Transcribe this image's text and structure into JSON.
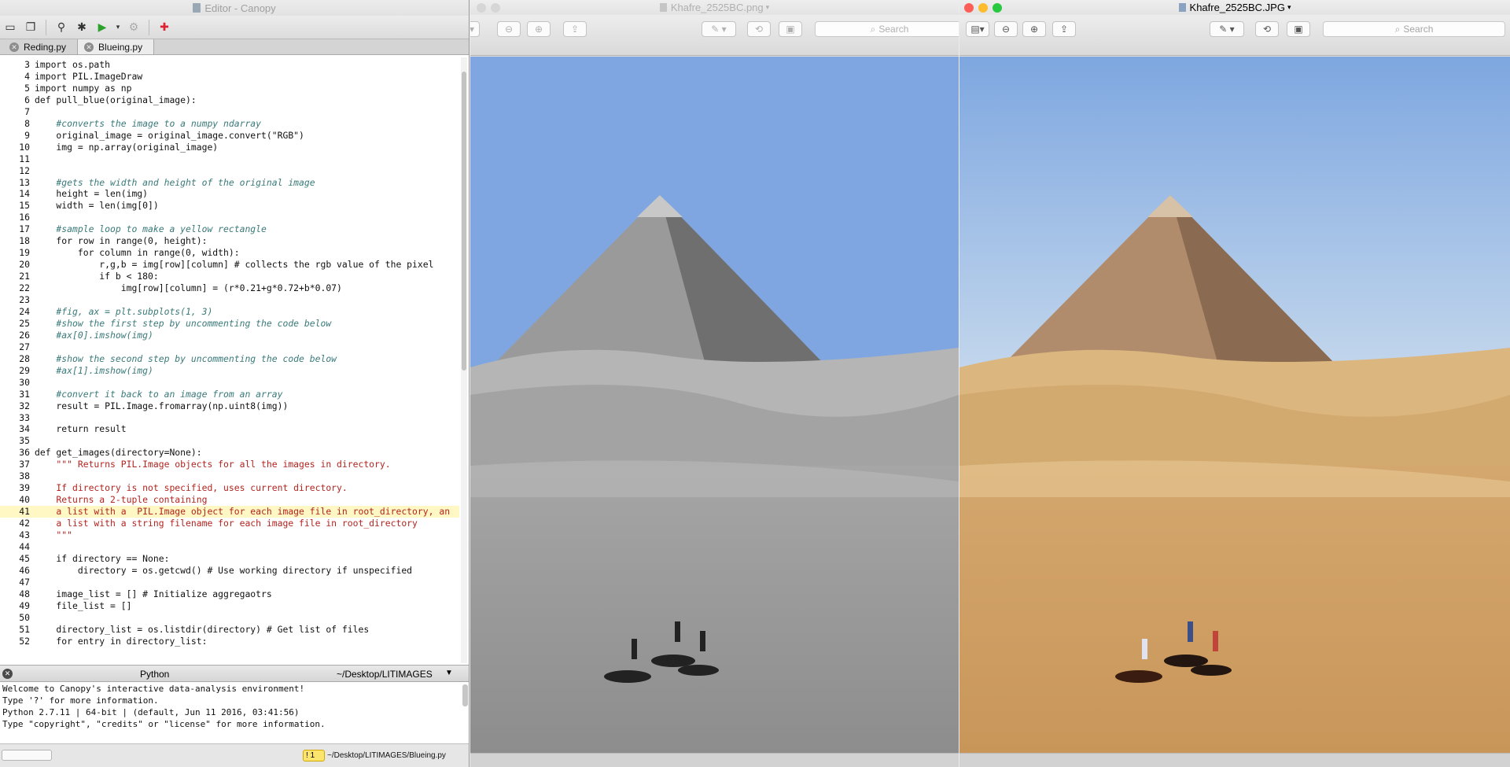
{
  "canopy": {
    "window_title": "Editor - Canopy",
    "tabs": [
      {
        "label": "Reding.py",
        "active": false
      },
      {
        "label": "Blueing.py",
        "active": true
      }
    ],
    "code": [
      {
        "n": "3",
        "text": "import os.path"
      },
      {
        "n": "4",
        "text": "import PIL.ImageDraw"
      },
      {
        "n": "5",
        "text": "import numpy as np"
      },
      {
        "n": "6",
        "text": "def pull_blue(original_image):"
      },
      {
        "n": "7",
        "text": ""
      },
      {
        "n": "8",
        "text": "    #converts the image to a numpy ndarray"
      },
      {
        "n": "9",
        "text": "    original_image = original_image.convert(\"RGB\")"
      },
      {
        "n": "10",
        "text": "    img = np.array(original_image)"
      },
      {
        "n": "11",
        "text": ""
      },
      {
        "n": "12",
        "text": ""
      },
      {
        "n": "13",
        "text": "    #gets the width and height of the original image"
      },
      {
        "n": "14",
        "text": "    height = len(img)"
      },
      {
        "n": "15",
        "text": "    width = len(img[0])"
      },
      {
        "n": "16",
        "text": ""
      },
      {
        "n": "17",
        "text": "    #sample loop to make a yellow rectangle"
      },
      {
        "n": "18",
        "text": "    for row in range(0, height):"
      },
      {
        "n": "19",
        "text": "        for column in range(0, width):"
      },
      {
        "n": "20",
        "text": "            r,g,b = img[row][column] # collects the rgb value of the pixel"
      },
      {
        "n": "21",
        "text": "            if b < 180:"
      },
      {
        "n": "22",
        "text": "                img[row][column] = (r*0.21+g*0.72+b*0.07)"
      },
      {
        "n": "23",
        "text": ""
      },
      {
        "n": "24",
        "text": "    #fig, ax = plt.subplots(1, 3)"
      },
      {
        "n": "25",
        "text": "    #show the first step by uncommenting the code below"
      },
      {
        "n": "26",
        "text": "    #ax[0].imshow(img)"
      },
      {
        "n": "27",
        "text": ""
      },
      {
        "n": "28",
        "text": "    #show the second step by uncommenting the code below"
      },
      {
        "n": "29",
        "text": "    #ax[1].imshow(img)"
      },
      {
        "n": "30",
        "text": ""
      },
      {
        "n": "31",
        "text": "    #convert it back to an image from an array"
      },
      {
        "n": "32",
        "text": "    result = PIL.Image.fromarray(np.uint8(img))"
      },
      {
        "n": "33",
        "text": ""
      },
      {
        "n": "34",
        "text": "    return result"
      },
      {
        "n": "35",
        "text": ""
      },
      {
        "n": "36",
        "text": "def get_images(directory=None):"
      },
      {
        "n": "37",
        "text": "    \"\"\" Returns PIL.Image objects for all the images in directory."
      },
      {
        "n": "38",
        "text": ""
      },
      {
        "n": "39",
        "text": "    If directory is not specified, uses current directory."
      },
      {
        "n": "40",
        "text": "    Returns a 2-tuple containing"
      },
      {
        "n": "41",
        "text": "    a list with a  PIL.Image object for each image file in root_directory, an"
      },
      {
        "n": "42",
        "text": "    a list with a string filename for each image file in root_directory"
      },
      {
        "n": "43",
        "text": "    \"\"\""
      },
      {
        "n": "44",
        "text": ""
      },
      {
        "n": "45",
        "text": "    if directory == None:"
      },
      {
        "n": "46",
        "text": "        directory = os.getcwd() # Use working directory if unspecified"
      },
      {
        "n": "47",
        "text": ""
      },
      {
        "n": "48",
        "text": "    image_list = [] # Initialize aggregaotrs"
      },
      {
        "n": "49",
        "text": "    file_list = []"
      },
      {
        "n": "50",
        "text": ""
      },
      {
        "n": "51",
        "text": "    directory_list = os.listdir(directory) # Get list of files"
      },
      {
        "n": "52",
        "text": "    for entry in directory_list:"
      }
    ],
    "current_line": "41",
    "python_panel": {
      "title": "Python",
      "path": "~/Desktop/LITIMAGES",
      "console": [
        "Welcome to Canopy's interactive data-analysis environment!",
        "Type '?' for more information.",
        "Python 2.7.11 | 64-bit | (default, Jun 11 2016, 03:41:56)",
        "Type \"copyright\", \"credits\" or \"license\" for more information."
      ]
    },
    "status": {
      "warning_count": "1",
      "file_path": "~/Desktop/LITIMAGES/Blueing.py"
    }
  },
  "preview_left": {
    "title": "Khafre_2525BC.png",
    "search_placeholder": "Search",
    "tone": "grayscale"
  },
  "preview_right": {
    "title": "Khafre_2525BC.JPG",
    "search_placeholder": "Search",
    "tone": "color"
  },
  "colors": {
    "sky_top": "#7fa8e2",
    "sand": "#d9b27a",
    "comment": "#3a7a7a",
    "keyword": "#006400",
    "string": "#b3241f"
  }
}
